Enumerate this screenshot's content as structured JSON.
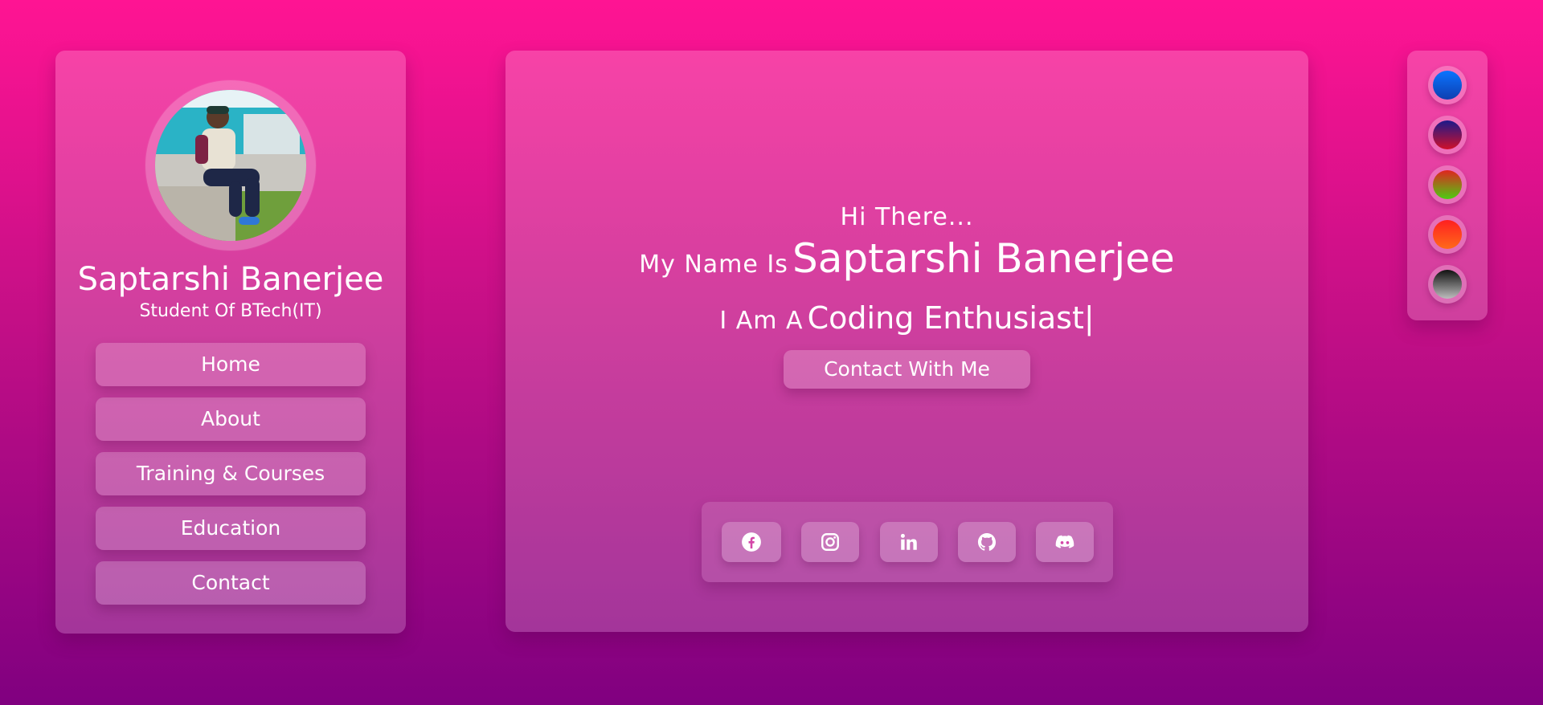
{
  "profile": {
    "name": "Saptarshi Banerjee",
    "role": "Student Of BTech(IT)"
  },
  "nav": {
    "items": [
      {
        "label": "Home"
      },
      {
        "label": "About"
      },
      {
        "label": "Training & Courses"
      },
      {
        "label": "Education"
      },
      {
        "label": "Contact"
      }
    ]
  },
  "hero": {
    "greeting": "Hi There...",
    "name_prefix": "My Name Is",
    "name": "Saptarshi Banerjee",
    "role_prefix": "I Am A",
    "typed_text": "Coding Enthusiast|",
    "contact_button": "Contact With Me"
  },
  "social": {
    "icons": [
      "facebook-icon",
      "instagram-icon",
      "linkedin-icon",
      "github-icon",
      "discord-icon"
    ]
  },
  "theme": {
    "swatches": [
      {
        "name": "blue",
        "colors": [
          "#0a74ff",
          "#0e3fb0"
        ]
      },
      {
        "name": "navy-red",
        "colors": [
          "#1b1a8a",
          "#d0102a"
        ]
      },
      {
        "name": "red-green",
        "colors": [
          "#e0241f",
          "#4ccd12"
        ]
      },
      {
        "name": "red-orange",
        "colors": [
          "#ff2020",
          "#ff6a1a"
        ]
      },
      {
        "name": "gray",
        "colors": [
          "#111111",
          "#bdbdbd"
        ]
      }
    ]
  },
  "colors": {
    "background_top": "#ff1493",
    "background_bottom": "#800080"
  }
}
